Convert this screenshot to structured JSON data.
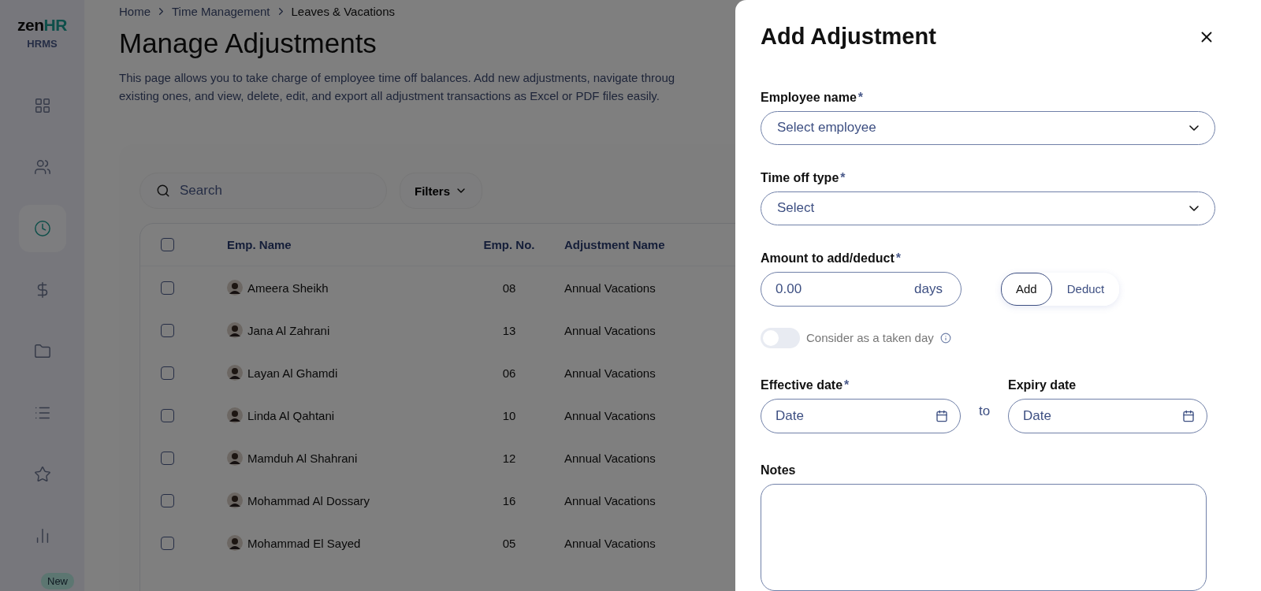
{
  "sidebar": {
    "logo": {
      "first": "zen",
      "second": "HR"
    },
    "subtitle": "HRMS",
    "items": [
      {
        "kind": "grid",
        "selected": false
      },
      {
        "kind": "people",
        "selected": false
      },
      {
        "kind": "clock",
        "selected": true
      },
      {
        "kind": "dollar",
        "selected": false
      },
      {
        "kind": "folder",
        "selected": false
      },
      {
        "kind": "list",
        "selected": false
      },
      {
        "kind": "star",
        "selected": false
      },
      {
        "kind": "chart",
        "selected": false
      }
    ],
    "badge": "New"
  },
  "breadcrumb": [
    "Home",
    "Time Management",
    "Leaves & Vacations"
  ],
  "title": "Manage Adjustments",
  "description": "This page allows you to take charge of employee time off balances. Add new adjustments, navigate throug existing ones, and view, delete, edit, and export all adjustment transactions as Excel or PDF files easily.",
  "search": {
    "placeholder": "Search"
  },
  "filters": "Filters",
  "table": {
    "columns": [
      "Emp. Name",
      "Emp. No.",
      "Adjustment Name"
    ],
    "header_checked": false,
    "rows": [
      {
        "checked": false,
        "name": "Ameera Sheikh",
        "number": "08",
        "adjustment": "Annual Vacations"
      },
      {
        "checked": false,
        "name": "Jana Al Zahrani",
        "number": "13",
        "adjustment": "Annual Vacations"
      },
      {
        "checked": false,
        "name": "Layan Al Ghamdi",
        "number": "06",
        "adjustment": "Annual Vacations"
      },
      {
        "checked": false,
        "name": "Linda Al Qahtani",
        "number": "10",
        "adjustment": "Annual Vacations"
      },
      {
        "checked": false,
        "name": "Mamduh Al Shahrani",
        "number": "12",
        "adjustment": "Annual Vacations"
      },
      {
        "checked": false,
        "name": "Mohammad Al Dossary",
        "number": "16",
        "adjustment": "Annual Vacations"
      },
      {
        "checked": false,
        "name": "Mohammad El Sayed",
        "number": "05",
        "adjustment": "Annual Vacations"
      }
    ]
  },
  "drawer": {
    "title": "Add Adjustment",
    "required_mark": "*",
    "employee": {
      "label": "Employee name",
      "required": true,
      "placeholder": "Select employee"
    },
    "time_off": {
      "label": "Time off type",
      "required": true,
      "placeholder": "Select"
    },
    "amount": {
      "label": "Amount to add/deduct",
      "required": true,
      "placeholder": "0.00",
      "unit": "days"
    },
    "modes": [
      {
        "label": "Add",
        "selected": true
      },
      {
        "label": "Deduct",
        "selected": false
      }
    ],
    "taken_day": {
      "label": "Consider as a taken day",
      "on": false
    },
    "effective": {
      "label": "Effective date",
      "required": true,
      "placeholder": "Date"
    },
    "separator": "to",
    "expiry": {
      "label": "Expiry date",
      "required": false,
      "placeholder": "Date"
    },
    "notes": {
      "label": "Notes"
    }
  }
}
